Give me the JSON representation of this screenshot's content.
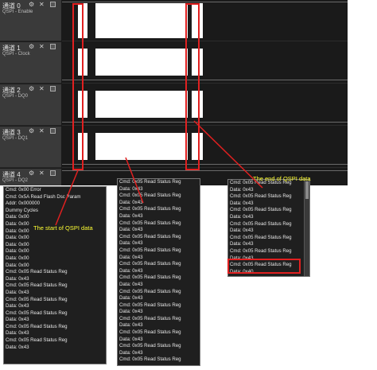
{
  "channels": [
    {
      "name": "通道 0",
      "subtitle": "QSPI - Enable"
    },
    {
      "name": "通道 1",
      "subtitle": "QSPI - Clock"
    },
    {
      "name": "通道 2",
      "subtitle": "QSPI - DQ0"
    },
    {
      "name": "通道 3",
      "subtitle": "QSPI - DQ1"
    },
    {
      "name": "通道 4",
      "subtitle": "QSPI - DQ2"
    }
  ],
  "icons": {
    "gear": "gear-icon",
    "close": "close-icon",
    "checkbox": "checkbox-icon"
  },
  "popup_left": {
    "rows": [
      "Cmd: 0x00 Error",
      "Cmd: 0x5A Read Flash Dsc Param",
      "Addr: 0x000000",
      "Dummy Cycles",
      "Data: 0x00",
      "Data: 0x00",
      "Data: 0x00",
      "Data: 0x00",
      "Data: 0x00",
      "Data: 0x00",
      "Data: 0x00",
      "Data: 0x00",
      "Cmd: 0x05 Read Status Reg",
      "Data: 0x43",
      "Cmd: 0x05 Read Status Reg",
      "Data: 0x43",
      "Cmd: 0x05 Read Status Reg",
      "Data: 0x43",
      "Cmd: 0x05 Read Status Reg",
      "Data: 0x43",
      "Cmd: 0x05 Read Status Reg",
      "Data: 0x43",
      "Cmd: 0x05 Read Status Reg",
      "Data: 0x43"
    ]
  },
  "popup_middle": {
    "rows": [
      "Cmd: 0x05 Read Status Reg",
      "Data: 0x43",
      "Cmd: 0x05 Read Status Reg",
      "Data: 0x43",
      "Cmd: 0x05 Read Status Reg",
      "Data: 0x43",
      "Cmd: 0x05 Read Status Reg",
      "Data: 0x43",
      "Cmd: 0x05 Read Status Reg",
      "Data: 0x43",
      "Cmd: 0x05 Read Status Reg",
      "Data: 0x43",
      "Cmd: 0x05 Read Status Reg",
      "Data: 0x43",
      "Cmd: 0x05 Read Status Reg",
      "Data: 0x43",
      "Cmd: 0x05 Read Status Reg",
      "Data: 0x43",
      "Cmd: 0x05 Read Status Reg",
      "Data: 0x43",
      "Cmd: 0x05 Read Status Reg",
      "Data: 0x43",
      "Cmd: 0x05 Read Status Reg",
      "Data: 0x43",
      "Cmd: 0x05 Read Status Reg",
      "Data: 0x43",
      "Cmd: 0x05 Read Status Reg"
    ]
  },
  "popup_right": {
    "rows": [
      "Cmd: 0x05 Read Status Reg",
      "Data: 0x43",
      "Cmd: 0x05 Read Status Reg",
      "Data: 0x43",
      "Cmd: 0x05 Read Status Reg",
      "Data: 0x43",
      "Cmd: 0x05 Read Status Reg",
      "Data: 0x43",
      "Cmd: 0x05 Read Status Reg",
      "Data: 0x43",
      "Cmd: 0x05 Read Status Reg",
      "Data: 0x43",
      "Cmd: 0x05 Read Status Reg",
      "Data: 0x40"
    ]
  },
  "annotations": {
    "start": "The start of QSPI data",
    "end": "The end of QSPI data"
  },
  "colors": {
    "annotation_line": "#e02020",
    "annotation_text": "#ffff33"
  }
}
